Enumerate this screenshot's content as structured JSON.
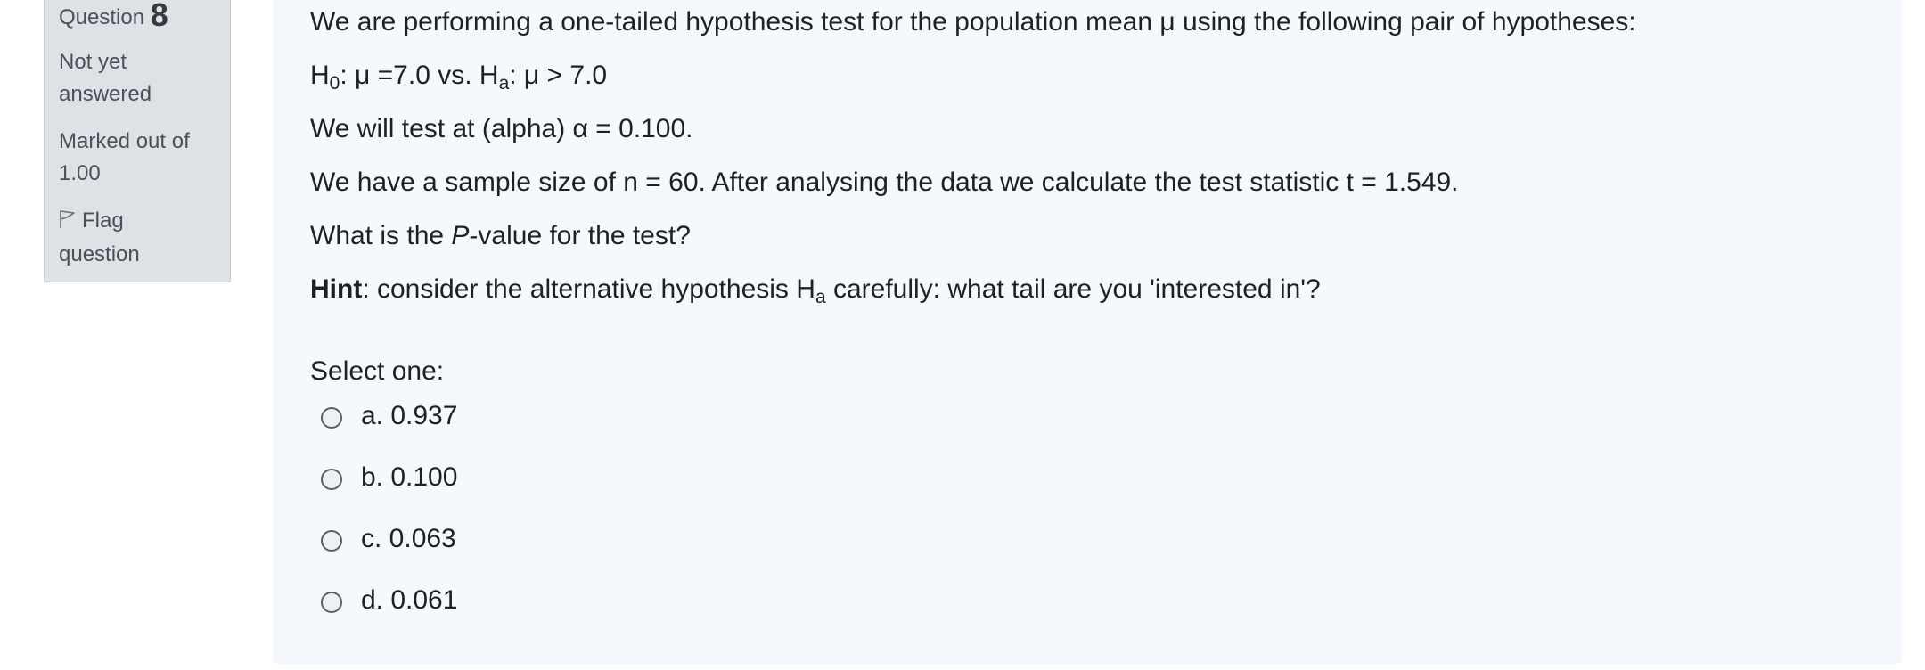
{
  "info": {
    "question_label": "Question",
    "question_number": "8",
    "state_line1": "Not yet",
    "state_line2": "answered",
    "grade_line1": "Marked out of",
    "grade_line2": "1.00",
    "flag_line1": "Flag",
    "flag_line2": "question",
    "flag_icon": "flag-icon"
  },
  "question": {
    "intro": "We are performing a one-tailed hypothesis test for the population mean μ using the following pair of hypotheses:",
    "h0_symbol": "H",
    "h0_sub": "0",
    "h0_text": ": μ =7.0 vs. ",
    "ha_symbol": "H",
    "ha_sub": "a",
    "ha_text": ": μ > 7.0",
    "alpha_text": "We will test at (alpha) α = 0.100.",
    "sample_text": "We have a sample size of n = 60. After analysing the data we calculate the test statistic t = 1.549.",
    "pvalue_before": "What is the ",
    "pvalue_italic": "P",
    "pvalue_after": "-value for the test?",
    "hint_bold": "Hint",
    "hint_before": ": consider the alternative hypothesis ",
    "hint_symbol": "H",
    "hint_sub": "a",
    "hint_after": " carefully: what tail are you 'interested in'?"
  },
  "answer": {
    "prompt": "Select one:",
    "options": [
      {
        "label": "a. 0.937"
      },
      {
        "label": "b. 0.100"
      },
      {
        "label": "c. 0.063"
      },
      {
        "label": "d. 0.061"
      }
    ]
  }
}
